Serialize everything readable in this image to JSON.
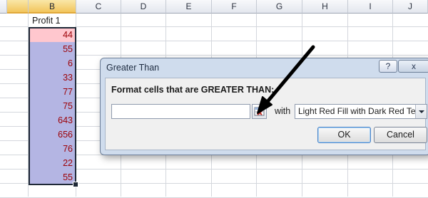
{
  "sheet": {
    "columns": [
      "B",
      "C",
      "D",
      "E",
      "F",
      "G",
      "H",
      "I",
      "J"
    ],
    "selected_column": "B",
    "header_cell": "Profit 1",
    "values": [
      "44",
      "55",
      "6",
      "33",
      "77",
      "75",
      "643",
      "656",
      "76",
      "22",
      "55"
    ],
    "colors": {
      "highlight_fill": "#ffc7ce",
      "selection_fill": "#b4b5e3",
      "dark_red_text": "#9c0006",
      "column_header_selected": "#f5c860"
    }
  },
  "dialog": {
    "title": "Greater Than",
    "help_label": "?",
    "close_label": "x",
    "prompt": "Format cells that are GREATER THAN:",
    "value_input": "",
    "ref_icon": "range-select-icon",
    "with_label": "with",
    "format_option": "Light Red Fill with Dark Red Text",
    "ok_label": "OK",
    "cancel_label": "Cancel"
  },
  "annotation": {
    "arrow_icon": "pointer-arrow-icon",
    "arrow_color": "#000000"
  }
}
